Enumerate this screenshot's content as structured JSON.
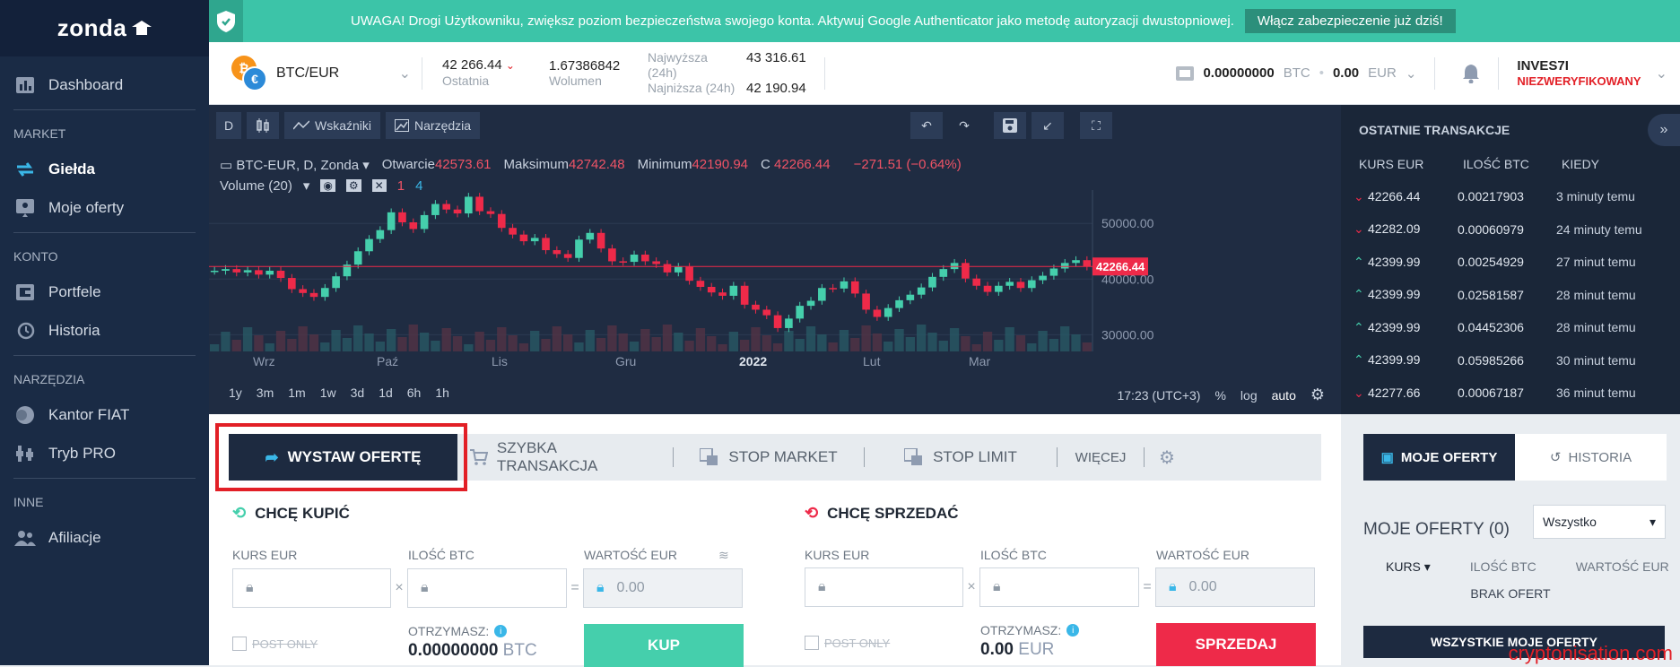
{
  "brand": {
    "name": "zonda"
  },
  "sidebar": {
    "dashboard": "Dashboard",
    "sections": {
      "market": "MARKET",
      "konto": "KONTO",
      "narzedzia": "NARZĘDZIA",
      "inne": "INNE"
    },
    "items": {
      "gielda": "Giełda",
      "moje_oferty": "Moje oferty",
      "portfele": "Portfele",
      "historia": "Historia",
      "kantor": "Kantor FIAT",
      "tryb_pro": "Tryb PRO",
      "afiliacje": "Afiliacje"
    }
  },
  "banner": {
    "message": "UWAGA! Drogi Użytkowniku, zwiększ poziom bezpieczeństwa swojego konta. Aktywuj Google Authenticator jako metodę autoryzacji dwustopniowej.",
    "cta": "Włącz zabezpieczenie już dziś!"
  },
  "topbar": {
    "pair": "BTC/EUR",
    "last_value": "42 266.44",
    "last_label": "Ostatnia",
    "volume_value": "1.67386842",
    "volume_label": "Wolumen",
    "high_label": "Najwyższa (24h)",
    "high_value": "43 316.61",
    "low_label": "Najniższa (24h)",
    "low_value": "42 190.94",
    "btc_balance": "0.00000000",
    "btc_unit": "BTC",
    "eur_balance": "0.00",
    "eur_unit": "EUR",
    "user_name": "INVES7I",
    "user_status": "NIEZWERYFIKOWANY",
    "colors": {
      "status": "#e21f26"
    }
  },
  "chart_toolbar": {
    "interval": "D",
    "indicators": "Wskaźniki",
    "tools": "Narzędzia"
  },
  "chart_legend": {
    "symbol": "BTC-EUR, D, Zonda",
    "open_label": "Otwarcie",
    "open_value": "42573.61",
    "high_label": "Maksimum",
    "high_value": "42742.48",
    "low_label": "Minimum",
    "low_value": "42190.94",
    "close_label": "C",
    "close_value": "42266.44",
    "change": "−271.51 (−0.64%)",
    "volume_label": "Volume (20)",
    "vol_a": "1",
    "vol_b": "4"
  },
  "chart_ranges": [
    "1y",
    "3m",
    "1m",
    "1w",
    "3d",
    "1d",
    "6h",
    "1h"
  ],
  "chart_footer": {
    "time": "17:23 (UTC+3)",
    "pct": "%",
    "log": "log",
    "auto": "auto"
  },
  "chart_data": {
    "type": "line",
    "x_labels": [
      "Wrz",
      "Paź",
      "Lis",
      "Gru",
      "2022",
      "Lut",
      "Mar"
    ],
    "y_ticks": [
      "50000.00",
      "40000.00",
      "30000.00"
    ],
    "ylim": [
      27000,
      56000
    ],
    "last_price_label": "42266.44",
    "series": [
      {
        "values": [
          41500,
          41800,
          41200,
          41600,
          40800,
          41500,
          40200,
          38200,
          37500,
          36800,
          38400,
          40500,
          42600,
          45000,
          47200,
          48800,
          52000,
          50200,
          49000,
          51500,
          53500,
          52500,
          51800,
          54800,
          52200,
          51700,
          49200,
          48000,
          46800,
          47400,
          45200,
          44500,
          43800,
          47100,
          48300,
          45500,
          43200,
          43100,
          44400,
          43200,
          42700,
          41200,
          42200,
          39700,
          38600,
          37600,
          37000,
          38800,
          35400,
          34500,
          33500,
          31200,
          32900,
          35200,
          36100,
          38400,
          38300,
          39600,
          37400,
          34500,
          33200,
          34800,
          36200,
          37200,
          38500,
          40400,
          41800,
          42900,
          40100,
          38800,
          37700,
          38800,
          39500,
          38400,
          39800,
          40600,
          41900,
          42900,
          43400,
          42266
        ]
      }
    ]
  },
  "trades": {
    "title": "OSTATNIE TRANSAKCJE",
    "headers": [
      "KURS EUR",
      "ILOŚĆ BTC",
      "KIEDY"
    ],
    "rows": [
      {
        "price": "42266.44",
        "amount": "0.00217903",
        "when": "3 minuty temu",
        "dir": "down"
      },
      {
        "price": "42282.09",
        "amount": "0.00060979",
        "when": "24 minuty temu",
        "dir": "down"
      },
      {
        "price": "42399.99",
        "amount": "0.00254929",
        "when": "27 minut temu",
        "dir": "up"
      },
      {
        "price": "42399.99",
        "amount": "0.02581587",
        "when": "28 minut temu",
        "dir": "up"
      },
      {
        "price": "42399.99",
        "amount": "0.04452306",
        "when": "28 minut temu",
        "dir": "up"
      },
      {
        "price": "42399.99",
        "amount": "0.05985266",
        "when": "30 minut temu",
        "dir": "up"
      },
      {
        "price": "42277.66",
        "amount": "0.00067187",
        "when": "36 minut temu",
        "dir": "down"
      }
    ]
  },
  "order_tabs": {
    "place": "WYSTAW OFERTĘ",
    "quick": "SZYBKA TRANSAKCJA",
    "stop_market": "STOP MARKET",
    "stop_limit": "STOP LIMIT",
    "more": "WIĘCEJ"
  },
  "buy": {
    "title": "CHCĘ KUPIĆ",
    "rate_label": "KURS EUR",
    "amount_label": "ILOŚĆ BTC",
    "value_label": "WARTOŚĆ EUR",
    "value": "0.00",
    "post_only": "POST ONLY",
    "receive_label": "OTRZYMASZ:",
    "receive_value": "0.00000000",
    "receive_unit": "BTC",
    "button": "KUP"
  },
  "sell": {
    "title": "CHCĘ SPRZEDAĆ",
    "rate_label": "KURS EUR",
    "amount_label": "ILOŚĆ BTC",
    "value_label": "WARTOŚĆ EUR",
    "value": "0.00",
    "post_only": "POST ONLY",
    "receive_label": "OTRZYMASZ:",
    "receive_value": "0.00",
    "receive_unit": "EUR",
    "button": "SPRZEDAJ"
  },
  "my_orders": {
    "tab_mine": "MOJE OFERTY",
    "tab_history": "HISTORIA",
    "title": "MOJE OFERTY (0)",
    "filter": "Wszystko",
    "cols": [
      "KURS",
      "ILOŚĆ BTC",
      "WARTOŚĆ EUR"
    ],
    "empty": "BRAK OFERT",
    "all_button": "WSZYSTKIE MOJE OFERTY"
  },
  "watermark": "cryptonisation.com",
  "colors": {
    "buy": "#45cfac",
    "sell": "#ee2a49",
    "accent": "#3cc4a8",
    "navy": "#1d2a40"
  }
}
